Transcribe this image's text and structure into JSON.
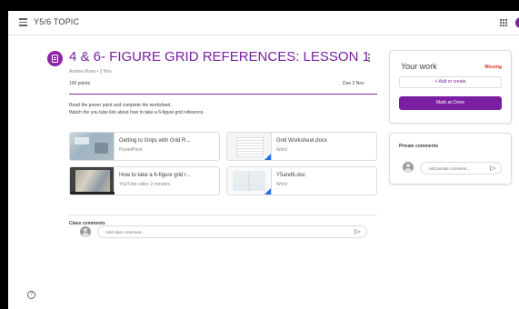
{
  "topbar": {
    "class_name": "Y5/6 TOPIC"
  },
  "assignment": {
    "title": "4 & 6- FIGURE GRID REFERENCES: LESSON 1",
    "meta": "Andrea Rose • 2 Nov",
    "points": "100 points",
    "due": "Due 2 Nov",
    "instructions": [
      "Read the power point and complete the worksheet.",
      "Watch the you tube link about how to take a 6-figure grid reference."
    ]
  },
  "attachments": [
    {
      "title": "Getting to Grips with Grid R...",
      "subtitle": "PowerPoint",
      "icon": "powerpoint-thumbnail-icon"
    },
    {
      "title": "Grid Worksheet.docx",
      "subtitle": "Word",
      "icon": "word-document-thumbnail-icon"
    },
    {
      "title": "How to take a 6-figure grid r...",
      "subtitle": "YouTube video   2 minutes",
      "icon": "youtube-video-thumbnail-icon"
    },
    {
      "title": "Y5and6.doc",
      "subtitle": "Word",
      "icon": "word-document-thumbnail-icon"
    }
  ],
  "class_comments": {
    "heading": "Class comments",
    "placeholder": "Add class comment..."
  },
  "your_work": {
    "title": "Your work",
    "status": "Missing",
    "add_label": "+ Add or create",
    "done_label": "Mark as Done"
  },
  "private_comments": {
    "heading": "Private comments",
    "placeholder": "Add private comment..."
  },
  "colors": {
    "accent": "#7b1fa2",
    "missing": "#d93025",
    "word_blue": "#1a73e8"
  },
  "icons": {
    "menu": "hamburger-menu-icon",
    "apps": "apps-grid-icon",
    "assignment": "assignment-icon",
    "more": "more-vert-icon",
    "send": "send-icon",
    "help": "help-icon"
  }
}
